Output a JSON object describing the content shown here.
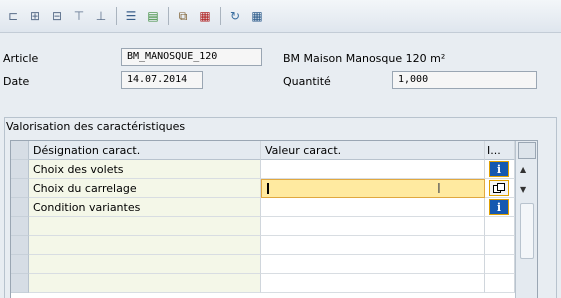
{
  "toolbar": {
    "icons": [
      "hierarchy-icon",
      "expand-all-icon",
      "collapse-all-icon",
      "sub-tree-icon",
      "sub-tree-alt-icon",
      "list-view-icon",
      "detail-view-icon",
      "copy-icon",
      "filter-icon",
      "reset-icon",
      "spreadsheet-icon"
    ]
  },
  "header": {
    "article_label": "Article",
    "article_value": "BM_MANOSQUE_120",
    "article_desc": "BM Maison Manosque 120 m²",
    "date_label": "Date",
    "date_value": "14.07.2014",
    "quantity_label": "Quantité",
    "quantity_value": "1,000"
  },
  "group": {
    "title": "Valorisation des caractéristiques"
  },
  "grid": {
    "columns": [
      "Désignation caract.",
      "Valeur caract.",
      "I..."
    ],
    "rows": [
      {
        "designation": "Choix des volets",
        "value": ""
      },
      {
        "designation": "Choix du carrelage",
        "value": ""
      },
      {
        "designation": "Condition variantes",
        "value": ""
      },
      {
        "designation": "",
        "value": ""
      },
      {
        "designation": "",
        "value": ""
      },
      {
        "designation": "",
        "value": ""
      },
      {
        "designation": "",
        "value": ""
      }
    ]
  }
}
